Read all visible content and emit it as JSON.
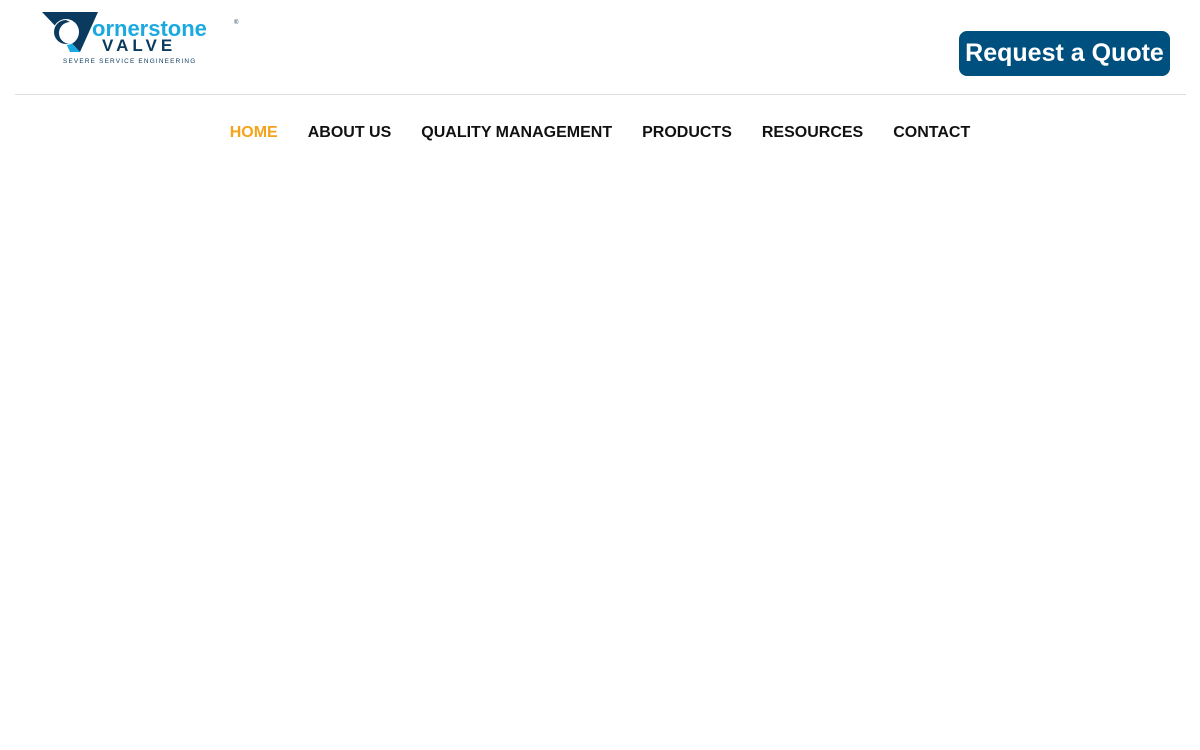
{
  "header": {
    "logo": {
      "wordmark_top": "ornerstone",
      "wordmark_bottom": "VALVE",
      "tagline": "SEVERE SERVICE ENGINEERING",
      "registered_mark": "®"
    },
    "quote_button_label": "Request a Quote"
  },
  "nav": {
    "items": [
      {
        "label": "HOME",
        "active": true
      },
      {
        "label": "ABOUT US",
        "active": false
      },
      {
        "label": "QUALITY MANAGEMENT",
        "active": false
      },
      {
        "label": "PRODUCTS",
        "active": false
      },
      {
        "label": "RESOURCES",
        "active": false
      },
      {
        "label": "CONTACT",
        "active": false
      }
    ]
  },
  "colors": {
    "brand_dark": "#00507f",
    "brand_light": "#1aa9e1",
    "nav_active": "#f5a31a",
    "nav_text": "#111111"
  }
}
